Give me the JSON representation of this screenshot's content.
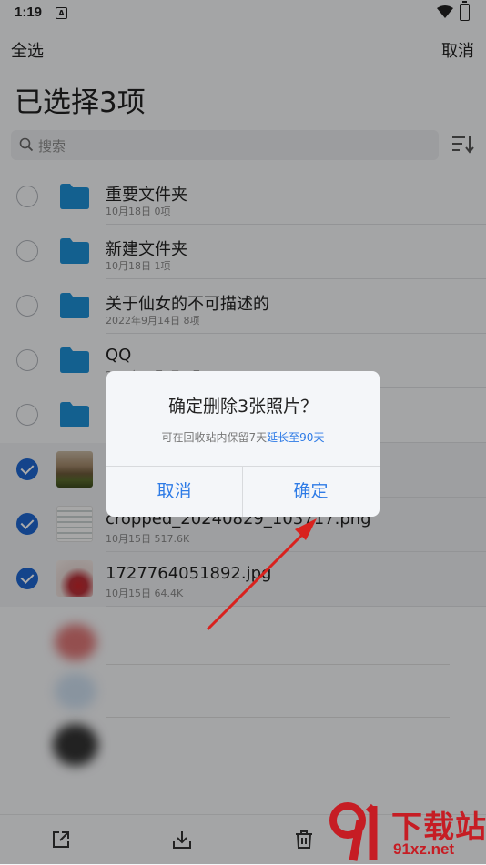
{
  "status_bar": {
    "time": "1:19",
    "notif_letter": "A"
  },
  "top_bar": {
    "select_all": "全选",
    "cancel": "取消"
  },
  "page_title": "已选择3项",
  "search": {
    "placeholder": "搜索"
  },
  "list": [
    {
      "type": "folder",
      "name": "重要文件夹",
      "meta": "10月18日  0项",
      "selected": false
    },
    {
      "type": "folder",
      "name": "新建文件夹",
      "meta": "10月18日  1项",
      "selected": false
    },
    {
      "type": "folder",
      "name": "关于仙女的不可描述的",
      "meta": "2022年9月14日  8项",
      "selected": false
    },
    {
      "type": "folder",
      "name": "QQ",
      "meta": "2021年10月1日  0项",
      "selected": false
    },
    {
      "type": "folder",
      "name": "",
      "meta": "",
      "selected": false
    },
    {
      "type": "image",
      "name": "",
      "meta": "",
      "selected": true
    },
    {
      "type": "image",
      "name": "cropped_20240829_103717.png",
      "meta": "10月15日  517.6K",
      "selected": true
    },
    {
      "type": "image",
      "name": "1727764051892.jpg",
      "meta": "10月15日  64.4K",
      "selected": true
    }
  ],
  "bottom_toolbar": {
    "icons": [
      "share-icon",
      "download-icon",
      "delete-icon"
    ]
  },
  "dialog": {
    "title": "确定删除3张照片？",
    "subtitle": "可在回收站内保留7天",
    "subtitle_link": "延长至90天",
    "cancel_label": "取消",
    "confirm_label": "确定"
  },
  "watermark": {
    "brand": "下载站",
    "domain": "91xz.net"
  },
  "colors": {
    "accent": "#2e7be6",
    "check": "#1e66d0",
    "folder": "#1d8fd6",
    "arrow": "#d9221e"
  }
}
